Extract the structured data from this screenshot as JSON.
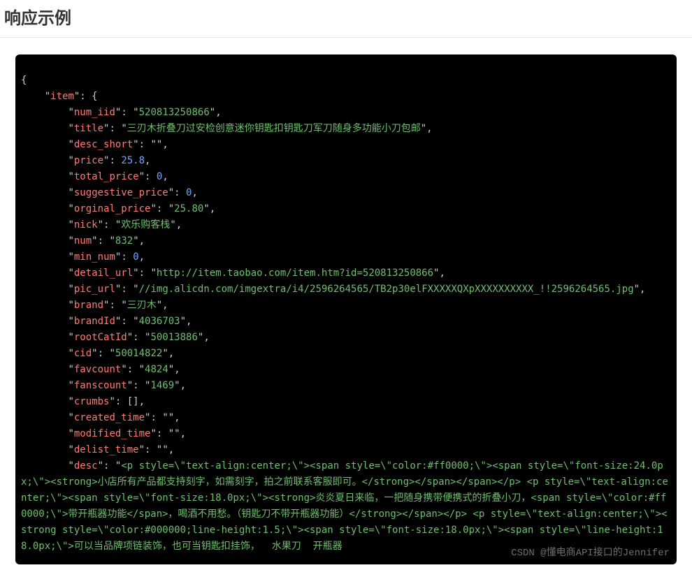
{
  "heading": "响应示例",
  "watermark": "CSDN @懂电商API接口的Jennifer",
  "json": {
    "k_item": "item",
    "k_num_iid": "num_iid",
    "v_num_iid": "520813250866",
    "k_title": "title",
    "v_title": "三刃木折叠刀过安检创意迷你钥匙扣钥匙刀军刀随身多功能小刀包邮",
    "k_desc_short": "desc_short",
    "v_desc_short": "",
    "k_price": "price",
    "v_price": "25.8",
    "k_total_price": "total_price",
    "v_total_price": "0",
    "k_suggestive_price": "suggestive_price",
    "v_suggestive_price": "0",
    "k_orginal_price": "orginal_price",
    "v_orginal_price": "25.80",
    "k_nick": "nick",
    "v_nick": "欢乐购客栈",
    "k_num": "num",
    "v_num": "832",
    "k_min_num": "min_num",
    "v_min_num": "0",
    "k_detail_url": "detail_url",
    "v_detail_url": "http://item.taobao.com/item.htm?id=520813250866",
    "k_pic_url": "pic_url",
    "v_pic_url": "//img.alicdn.com/imgextra/i4/2596264565/TB2p30elFXXXXXQXpXXXXXXXXXX_!!2596264565.jpg",
    "k_brand": "brand",
    "v_brand": "三刃木",
    "k_brandId": "brandId",
    "v_brandId": "4036703",
    "k_rootCatId": "rootCatId",
    "v_rootCatId": "50013886",
    "k_cid": "cid",
    "v_cid": "50014822",
    "k_favcount": "favcount",
    "v_favcount": "4824",
    "k_fanscount": "fanscount",
    "v_fanscount": "1469",
    "k_crumbs": "crumbs",
    "k_created_time": "created_time",
    "v_created_time": "",
    "k_modified_time": "modified_time",
    "v_modified_time": "",
    "k_delist_time": "delist_time",
    "v_delist_time": "",
    "k_desc": "desc",
    "v_desc_1": "<p style=\\\"text-align:center;\\\"><span style=\\\"color:#ff0000;\\\"><span style=\\\"font-size:24.0px;\\\"><strong>小店所有产品都支持刻字，如需刻字，拍之前联系客服即可。</strong></span></span></p> <p style=\\\"text-align:center;\\\"><span style=\\\"font-size:18.0px;\\\"><strong>炎炎夏日来临，一把随身携带便携式的折叠小刀，<span style=\\\"color:#ff0000;\\\">带开瓶器功能</span>，喝酒不用愁。（钥匙刀不带开瓶器功能）</strong></span></p> <p style=\\\"text-align:center;\\\"><strong style=\\\"color:#000000;line-height:1.5;\\\"><span style=\\\"font-size:18.0px;\\\"><span style=\\\"line-height:18.0px;\\\">可以当品牌项链装饰，也可当钥匙扣挂饰，  水果刀  开瓶器"
  }
}
